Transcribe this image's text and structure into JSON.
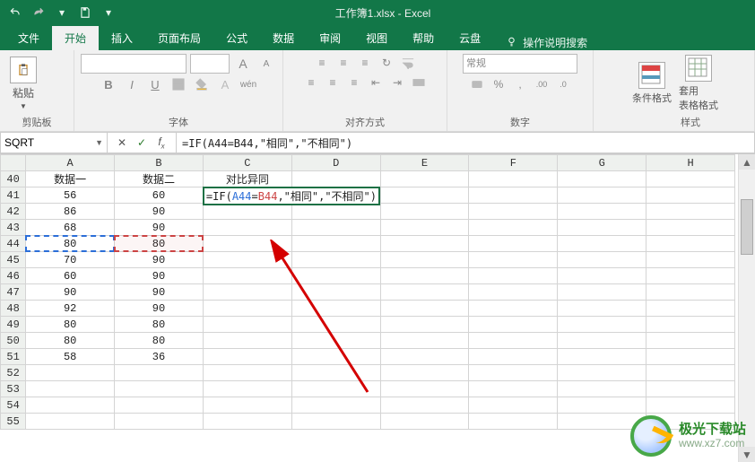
{
  "title": "工作簿1.xlsx  -  Excel",
  "tabs": {
    "file": "文件",
    "home": "开始",
    "insert": "插入",
    "layout": "页面布局",
    "formula": "公式",
    "data": "数据",
    "review": "审阅",
    "view": "视图",
    "help": "帮助",
    "cloud": "云盘",
    "tellme": "操作说明搜索"
  },
  "ribbon": {
    "clipboard": {
      "label": "剪贴板",
      "paste": "粘贴"
    },
    "font": {
      "label": "字体",
      "grow": "A",
      "shrink": "A",
      "bold": "B",
      "italic": "I",
      "underline": "U",
      "wen": "wén"
    },
    "align": {
      "label": "对齐方式"
    },
    "number": {
      "label": "数字",
      "general": "常规"
    },
    "styles": {
      "label": "样式",
      "cond": "条件格式",
      "table": "套用\n表格格式"
    }
  },
  "namebox": "SQRT",
  "formula": "=IF(A44=B44,\"相同\",\"不相同\")",
  "formula_parts": {
    "p1": "=IF(",
    "a": "A44",
    "eq": "=",
    "b": "B44",
    "p2": ",\"相同\",\"不相同\")"
  },
  "columns": [
    "A",
    "B",
    "C",
    "D",
    "E",
    "F",
    "G",
    "H"
  ],
  "row_start": 40,
  "row_count": 16,
  "headers": {
    "A": "数据一",
    "B": "数据二",
    "C": "对比异同"
  },
  "rows": [
    {
      "n": 40,
      "A": "数据一",
      "B": "数据二",
      "C": "对比异同"
    },
    {
      "n": 41,
      "A": "56",
      "B": "60",
      "Cformula": true
    },
    {
      "n": 42,
      "A": "86",
      "B": "90"
    },
    {
      "n": 43,
      "A": "68",
      "B": "90"
    },
    {
      "n": 44,
      "A": "80",
      "B": "80"
    },
    {
      "n": 45,
      "A": "70",
      "B": "90"
    },
    {
      "n": 46,
      "A": "60",
      "B": "90"
    },
    {
      "n": 47,
      "A": "90",
      "B": "90"
    },
    {
      "n": 48,
      "A": "92",
      "B": "90"
    },
    {
      "n": 49,
      "A": "80",
      "B": "80"
    },
    {
      "n": 50,
      "A": "80",
      "B": "80"
    },
    {
      "n": 51,
      "A": "58",
      "B": "36"
    },
    {
      "n": 52
    },
    {
      "n": 53
    },
    {
      "n": 54
    },
    {
      "n": 55
    }
  ],
  "watermark": {
    "t1": "极光下载站",
    "t2": "www.xz7.com"
  }
}
